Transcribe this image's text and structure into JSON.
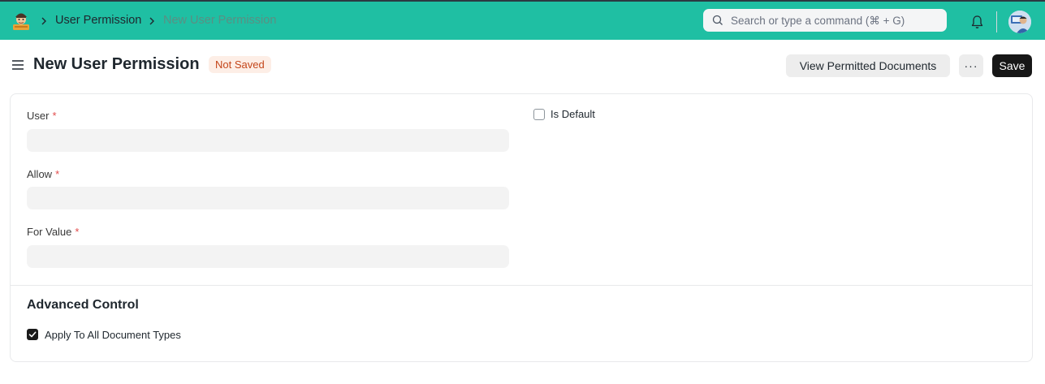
{
  "navbar": {
    "breadcrumbs": [
      "User Permission",
      "New User Permission"
    ],
    "search_placeholder": "Search or type a command (⌘ + G)"
  },
  "page": {
    "title": "New User Permission",
    "status_badge": "Not Saved",
    "view_button": "View Permitted Documents",
    "more_button": "···",
    "save_button": "Save"
  },
  "form": {
    "user_label": "User",
    "allow_label": "Allow",
    "for_value_label": "For Value",
    "required_mark": "*",
    "user_value": "",
    "allow_value": "",
    "for_value_value": "",
    "is_default_label": "Is Default",
    "is_default_checked": false
  },
  "advanced": {
    "title": "Advanced Control",
    "apply_all_label": "Apply To All Document Types",
    "apply_all_checked": true
  },
  "colors": {
    "navbar": "#1fbfa3",
    "badge_bg": "#fdeee6",
    "badge_text": "#c4461a",
    "save_bg": "#171717",
    "required": "#e24c4c"
  }
}
